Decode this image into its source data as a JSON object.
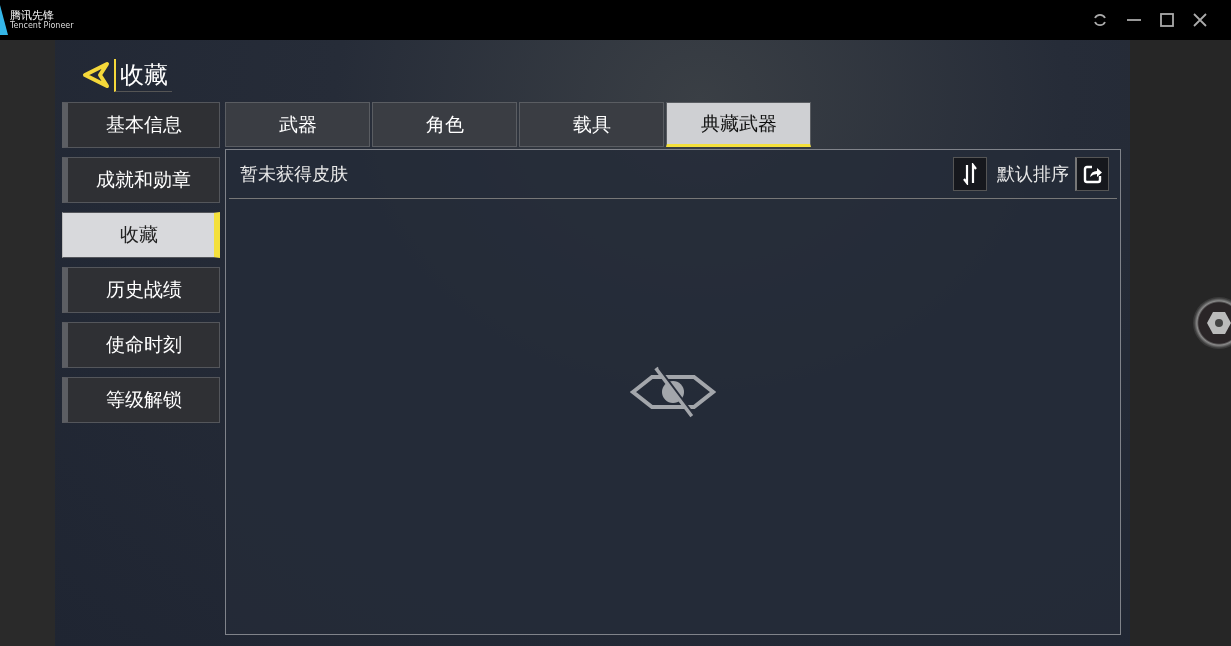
{
  "window": {
    "app_name": "腾讯先锋",
    "app_subtitle": "Tencent Pioneer"
  },
  "header": {
    "title": "收藏"
  },
  "sidebar": {
    "items": [
      {
        "label": "基本信息",
        "selected": false
      },
      {
        "label": "成就和勋章",
        "selected": false
      },
      {
        "label": "收藏",
        "selected": true
      },
      {
        "label": "历史战绩",
        "selected": false
      },
      {
        "label": "使命时刻",
        "selected": false
      },
      {
        "label": "等级解锁",
        "selected": false
      }
    ]
  },
  "tabs": [
    {
      "label": "武器",
      "selected": false
    },
    {
      "label": "角色",
      "selected": false
    },
    {
      "label": "载具",
      "selected": false
    },
    {
      "label": "典藏武器",
      "selected": true
    }
  ],
  "panel": {
    "status": "暂未获得皮肤",
    "sort_label": "默认排序"
  }
}
